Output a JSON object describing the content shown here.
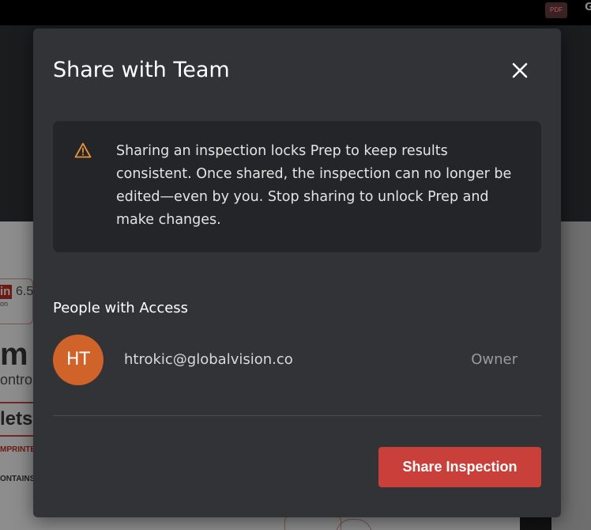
{
  "background": {
    "topbar": {
      "pdf_badge": "PDF",
      "right_letter": "G"
    },
    "document": {
      "logo_letters": "in",
      "version": "6.5",
      "tiny_text": "on",
      "big_text": "m",
      "sub_text": "ontrol",
      "lets_text": "lets",
      "imprint_text": "MPRINTE",
      "contains_text": "ONTAINS:"
    }
  },
  "modal": {
    "title": "Share with Team",
    "close_icon": "close-icon",
    "warning": {
      "icon": "warning-triangle-icon",
      "text": "Sharing an inspection locks Prep to keep results consistent. Once shared, the inspection can no longer be edited—even by you. Stop sharing to unlock Prep and make changes."
    },
    "access": {
      "heading": "People with Access",
      "people": [
        {
          "initials": "HT",
          "email": "htrokic@globalvision.co",
          "role": "Owner"
        }
      ]
    },
    "share_button_label": "Share Inspection"
  },
  "colors": {
    "modal_bg": "#323337",
    "warning_bg": "#242528",
    "warning_icon": "#e8923a",
    "avatar_bg": "#d0632a",
    "primary_button": "#c9403a"
  }
}
